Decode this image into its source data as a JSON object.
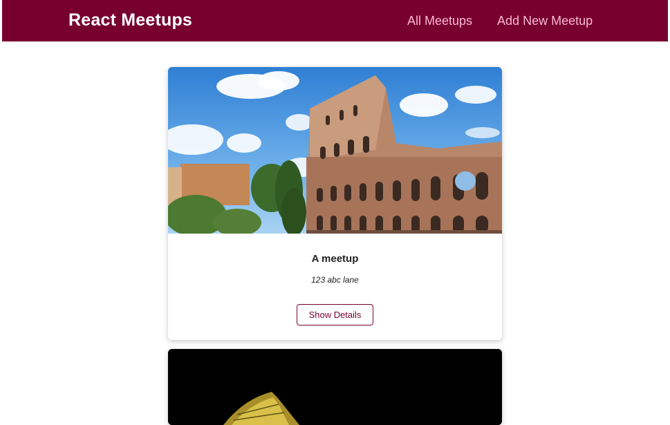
{
  "header": {
    "logo": "React Meetups",
    "nav": [
      "All Meetups",
      "Add New Meetup"
    ]
  },
  "meetups": [
    {
      "image": "colosseum-daytime-photo",
      "title": "A meetup",
      "address": "123 abc lane",
      "button_label": "Show Details"
    },
    {
      "image": "colosseum-night-photo"
    }
  ],
  "colors": {
    "header_bg": "#77002e",
    "nav_link": "#fcb8d2",
    "accent": "#77002e"
  }
}
